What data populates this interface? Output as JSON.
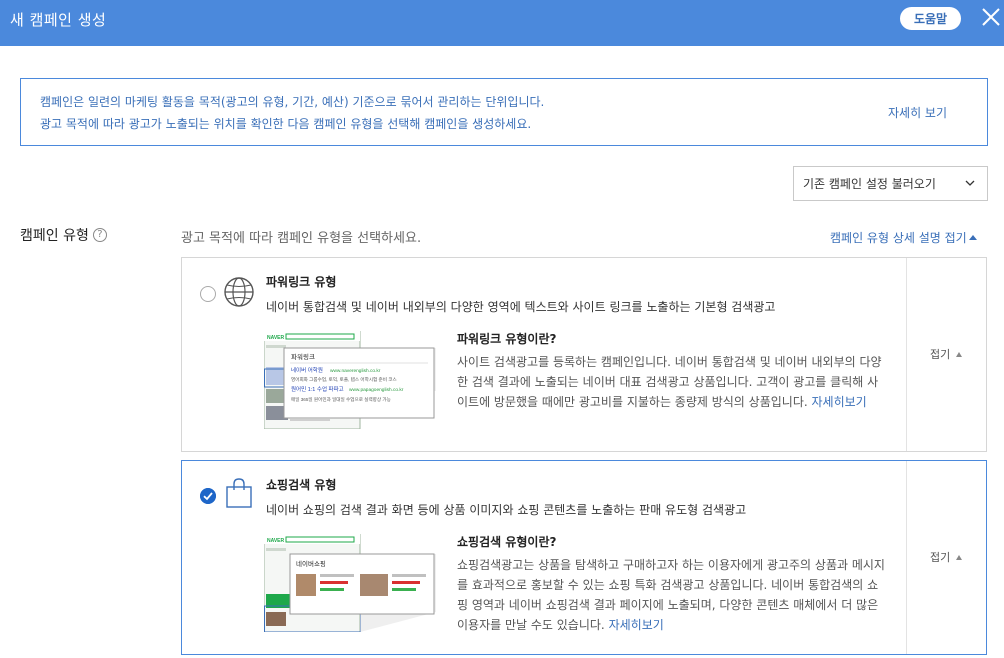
{
  "header": {
    "title": "새 캠페인 생성",
    "help_label": "도움말"
  },
  "info": {
    "line1": "캠페인은 일련의 마케팅 활동을 목적(광고의 유형, 기간, 예산) 기준으로 묶어서 관리하는 단위입니다.",
    "line2": "광고 목적에 따라 광고가 노출되는 위치를 확인한 다음 캠페인 유형을 선택해 캠페인을 생성하세요.",
    "more_label": "자세히 보기"
  },
  "load_button": {
    "label": "기존 캠페인 설정 불러오기"
  },
  "section": {
    "label": "캠페인 유형",
    "instruction": "광고 목적에 따라 캠페인 유형을 선택하세요.",
    "collapse_label": "캠페인 유형 상세 설명 접기"
  },
  "campaign_types": [
    {
      "name": "파워링크 유형",
      "description": "네이버 통합검색 및 네이버 내외부의 다양한 영역에 텍스트와 사이트 링크를 노출하는 기본형 검색광고",
      "sub_title": "파워링크 유형이란?",
      "body": "사이트 검색광고를 등록하는 캠페인입니다. 네이버 통합검색 및 네이버 내외부의 다양한 검색 결과에 노출되는 네이버 대표 검색광고 상품입니다. 고객이 광고를 클릭해 사이트에 방문했을 때에만 광고비를 지불하는 종량제 방식의 상품입니다.",
      "more_label": "자세히보기",
      "fold_label": "접기",
      "selected": false,
      "thumb": {
        "brand": "NAVER",
        "panel_title": "파워링크",
        "ad1_title": "네이버 어학원",
        "ad1_url": "www.naverenglish.co.kr",
        "ad1_desc": "영어회화 그룹수업, 토익, 토플, 텝스 어학시험 준비 코스",
        "ad2_title": "원어민 1:1 수업 파파고",
        "ad2_url": "www.papagoenglish.co.kr",
        "ad2_desc": "매일 365일 원어민과 일대일 수업으로 실력향상 가능"
      }
    },
    {
      "name": "쇼핑검색 유형",
      "description": "네이버 쇼핑의 검색 결과 화면 등에 상품 이미지와 쇼핑 콘텐츠를 노출하는 판매 유도형 검색광고",
      "sub_title": "쇼핑검색 유형이란?",
      "body": "쇼핑검색광고는 상품을 탐색하고 구매하고자 하는 이용자에게 광고주의 상품과 메시지를 효과적으로 홍보할 수 있는 쇼핑 특화 검색광고 상품입니다. 네이버 통합검색의 쇼핑 영역과 네이버 쇼핑검색 결과 페이지에 노출되며, 다양한 콘텐츠 매체에서 더 많은 이용자를 만날 수도 있습니다.",
      "more_label": "자세히보기",
      "fold_label": "접기",
      "selected": true,
      "thumb": {
        "brand": "NAVER",
        "panel_title": "네이버쇼핑"
      }
    }
  ],
  "colors": {
    "header": "#4b89dc",
    "link": "#3a6fb8",
    "check": "#1e66c8",
    "border": "#d6d6d6"
  },
  "icons": {
    "close": "close-icon",
    "help": "question-circle-icon",
    "globe": "globe-icon",
    "bag": "shopping-bag-icon",
    "check": "check-icon"
  }
}
